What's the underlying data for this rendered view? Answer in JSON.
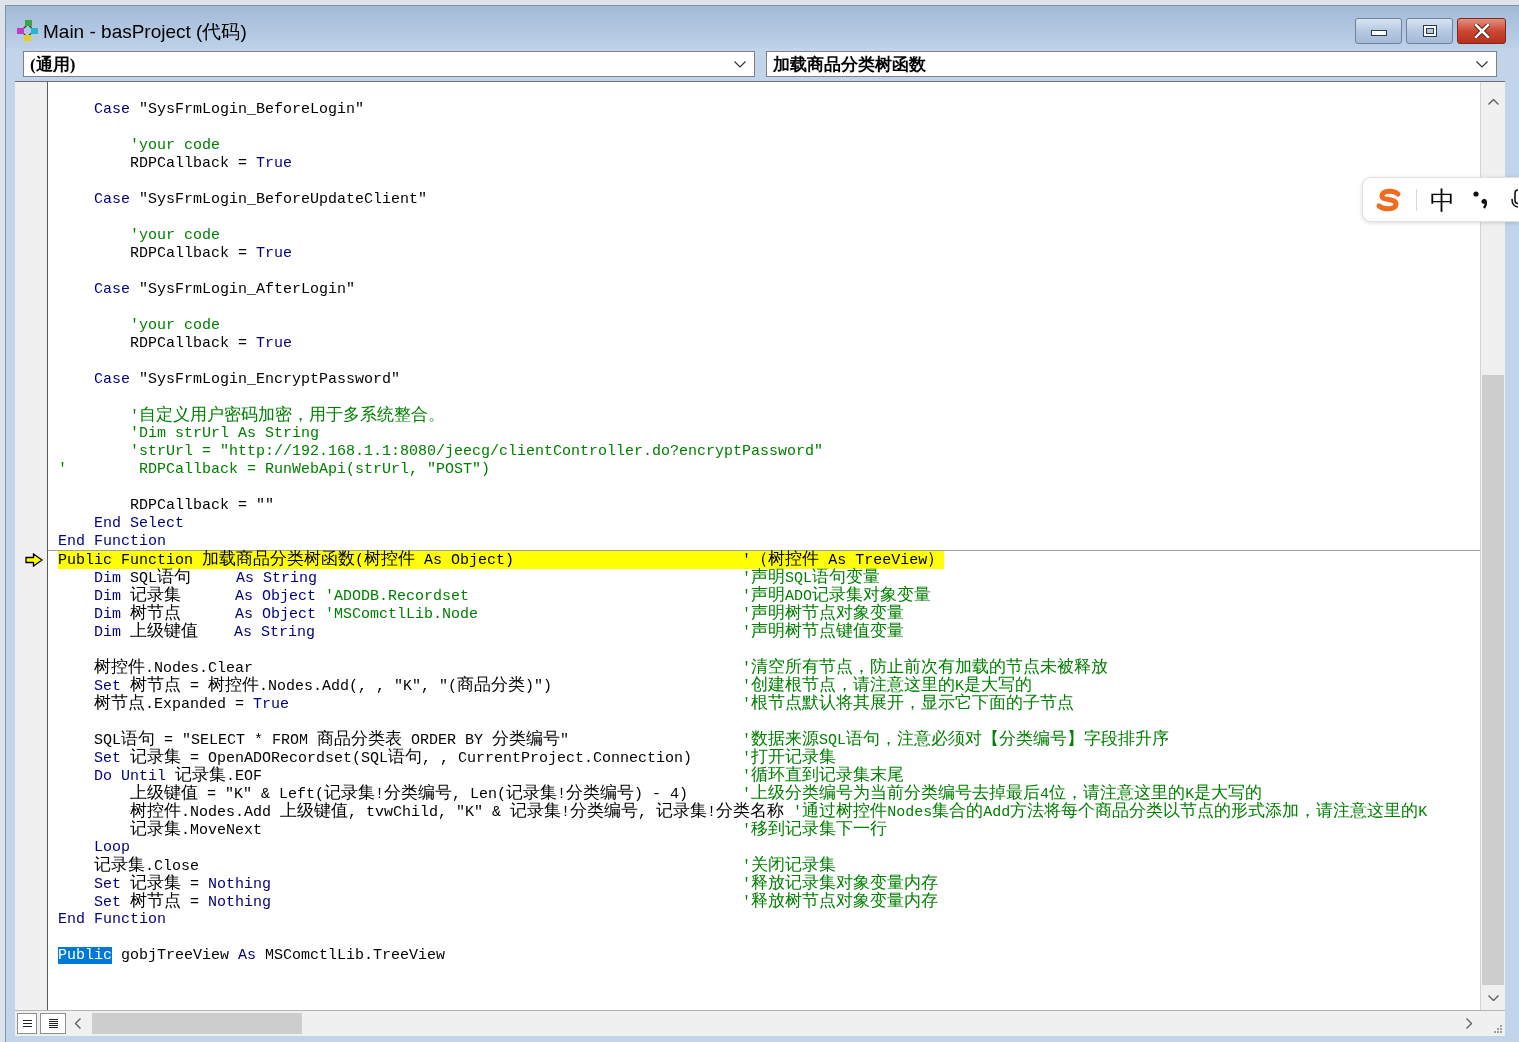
{
  "window": {
    "title": "Main - basProject (代码)"
  },
  "object_dropdown": {
    "value": "(通用)"
  },
  "procedure_dropdown": {
    "value": "加载商品分类树函数"
  },
  "code": {
    "procedures": [
      {
        "lines": [
          {
            "kind": "code",
            "current": false,
            "segments": [
              {
                "kind": "keyword",
                "text": "    Case"
              },
              {
                "kind": "plain",
                "text": " \"SysFrmLogin_BeforeLogin\""
              }
            ]
          },
          {
            "kind": "blank"
          },
          {
            "kind": "code",
            "current": false,
            "segments": [
              {
                "kind": "comment",
                "text": "        'your code"
              }
            ]
          },
          {
            "kind": "code",
            "current": false,
            "segments": [
              {
                "kind": "plain",
                "text": "        RDPCallback = "
              },
              {
                "kind": "keyword",
                "text": "True"
              }
            ]
          },
          {
            "kind": "blank"
          },
          {
            "kind": "code",
            "current": false,
            "segments": [
              {
                "kind": "keyword",
                "text": "    Case"
              },
              {
                "kind": "plain",
                "text": " \"SysFrmLogin_BeforeUpdateClient\""
              }
            ]
          },
          {
            "kind": "blank"
          },
          {
            "kind": "code",
            "current": false,
            "segments": [
              {
                "kind": "comment",
                "text": "        'your code"
              }
            ]
          },
          {
            "kind": "code",
            "current": false,
            "segments": [
              {
                "kind": "plain",
                "text": "        RDPCallback = "
              },
              {
                "kind": "keyword",
                "text": "True"
              }
            ]
          },
          {
            "kind": "blank"
          },
          {
            "kind": "code",
            "current": false,
            "segments": [
              {
                "kind": "keyword",
                "text": "    Case"
              },
              {
                "kind": "plain",
                "text": " \"SysFrmLogin_AfterLogin\""
              }
            ]
          },
          {
            "kind": "blank"
          },
          {
            "kind": "code",
            "current": false,
            "segments": [
              {
                "kind": "comment",
                "text": "        'your code"
              }
            ]
          },
          {
            "kind": "code",
            "current": false,
            "segments": [
              {
                "kind": "plain",
                "text": "        RDPCallback = "
              },
              {
                "kind": "keyword",
                "text": "True"
              }
            ]
          },
          {
            "kind": "blank"
          },
          {
            "kind": "code",
            "current": false,
            "segments": [
              {
                "kind": "keyword",
                "text": "    Case"
              },
              {
                "kind": "plain",
                "text": " \"SysFrmLogin_EncryptPassword\""
              }
            ]
          },
          {
            "kind": "blank"
          },
          {
            "kind": "code",
            "current": false,
            "segments": [
              {
                "kind": "comment",
                "text": "        '自定义用户密码加密，用于多系统整合。"
              }
            ]
          },
          {
            "kind": "code",
            "current": false,
            "segments": [
              {
                "kind": "comment",
                "text": "        'Dim strUrl As String"
              }
            ]
          },
          {
            "kind": "code",
            "current": false,
            "segments": [
              {
                "kind": "comment",
                "text": "        'strUrl = \"http://192.168.1.1:8080/jeecg/clientController.do?encryptPassword\""
              }
            ]
          },
          {
            "kind": "code",
            "current": false,
            "segments": [
              {
                "kind": "comment",
                "text": "'        RDPCallback = RunWebApi(strUrl, \"POST\")"
              }
            ]
          },
          {
            "kind": "blank"
          },
          {
            "kind": "code",
            "current": false,
            "segments": [
              {
                "kind": "plain",
                "text": "        RDPCallback = \"\""
              }
            ]
          },
          {
            "kind": "code",
            "current": false,
            "segments": [
              {
                "kind": "keyword",
                "text": "    End Select"
              }
            ]
          },
          {
            "kind": "code",
            "current": false,
            "segments": [
              {
                "kind": "keyword",
                "text": "End Function"
              }
            ]
          }
        ]
      },
      {
        "lines": [
          {
            "kind": "code",
            "current": true,
            "segments": [
              {
                "kind": "plain",
                "text": "Public Function 加载商品分类树函数(树控件 As Object)"
              }
            ],
            "comment": "'（树控件 As TreeView）"
          },
          {
            "kind": "code",
            "current": false,
            "segments": [
              {
                "kind": "keyword",
                "text": "    Dim"
              },
              {
                "kind": "plain",
                "text": " SQL语句     "
              },
              {
                "kind": "keyword",
                "text": "As String"
              }
            ],
            "comment": "'声明SQL语句变量"
          },
          {
            "kind": "code",
            "current": false,
            "segments": [
              {
                "kind": "keyword",
                "text": "    Dim"
              },
              {
                "kind": "plain",
                "text": " 记录集      "
              },
              {
                "kind": "keyword",
                "text": "As Object"
              },
              {
                "kind": "comment",
                "text": " 'ADODB.Recordset"
              }
            ],
            "comment": "'声明ADO记录集对象变量"
          },
          {
            "kind": "code",
            "current": false,
            "segments": [
              {
                "kind": "keyword",
                "text": "    Dim"
              },
              {
                "kind": "plain",
                "text": " 树节点      "
              },
              {
                "kind": "keyword",
                "text": "As Object"
              },
              {
                "kind": "comment",
                "text": " 'MSComctlLib.Node"
              }
            ],
            "comment": "'声明树节点对象变量"
          },
          {
            "kind": "code",
            "current": false,
            "segments": [
              {
                "kind": "keyword",
                "text": "    Dim"
              },
              {
                "kind": "plain",
                "text": " 上级键值    "
              },
              {
                "kind": "keyword",
                "text": "As String"
              }
            ],
            "comment": "'声明树节点键值变量"
          },
          {
            "kind": "blank"
          },
          {
            "kind": "code",
            "current": false,
            "segments": [
              {
                "kind": "plain",
                "text": "    树控件.Nodes.Clear"
              }
            ],
            "comment": "'清空所有节点，防止前次有加载的节点未被释放"
          },
          {
            "kind": "code",
            "current": false,
            "segments": [
              {
                "kind": "keyword",
                "text": "    Set"
              },
              {
                "kind": "plain",
                "text": " 树节点 = 树控件.Nodes.Add(, , \"K\", \"(商品分类)\")"
              }
            ],
            "comment": "'创建根节点，请注意这里的K是大写的"
          },
          {
            "kind": "code",
            "current": false,
            "segments": [
              {
                "kind": "plain",
                "text": "    树节点.Expanded = "
              },
              {
                "kind": "keyword",
                "text": "True"
              }
            ],
            "comment": "'根节点默认将其展开，显示它下面的子节点"
          },
          {
            "kind": "blank"
          },
          {
            "kind": "code",
            "current": false,
            "segments": [
              {
                "kind": "plain",
                "text": "    SQL语句 = \"SELECT * FROM 商品分类表 ORDER BY 分类编号\""
              }
            ],
            "comment": "'数据来源SQL语句，注意必须对【分类编号】字段排升序"
          },
          {
            "kind": "code",
            "current": false,
            "segments": [
              {
                "kind": "keyword",
                "text": "    Set"
              },
              {
                "kind": "plain",
                "text": " 记录集 = OpenADORecordset(SQL语句, , CurrentProject.Connection)"
              }
            ],
            "comment": "'打开记录集"
          },
          {
            "kind": "code",
            "current": false,
            "segments": [
              {
                "kind": "keyword",
                "text": "    Do Until"
              },
              {
                "kind": "plain",
                "text": " 记录集.EOF"
              }
            ],
            "comment": "'循环直到记录集末尾"
          },
          {
            "kind": "code",
            "current": false,
            "segments": [
              {
                "kind": "plain",
                "text": "        上级键值 = \"K\" & Left(记录集!分类编号, Len(记录集!分类编号) - 4)"
              }
            ],
            "comment": "'上级分类编号为当前分类编号去掉最后4位，请注意这里的K是大写的"
          },
          {
            "kind": "code",
            "current": false,
            "segments": [
              {
                "kind": "plain",
                "text": "        树控件.Nodes.Add 上级键值, tvwChild, \"K\" & 记录集!分类编号, 记录集!分类名称"
              }
            ],
            "comment": "'通过树控件Nodes集合的Add方法将每个商品分类以节点的形式添加，请注意这里的K"
          },
          {
            "kind": "code",
            "current": false,
            "segments": [
              {
                "kind": "plain",
                "text": "        记录集.MoveNext"
              }
            ],
            "comment": "'移到记录集下一行"
          },
          {
            "kind": "code",
            "current": false,
            "segments": [
              {
                "kind": "keyword",
                "text": "    Loop"
              }
            ]
          },
          {
            "kind": "code",
            "current": false,
            "segments": [
              {
                "kind": "plain",
                "text": "    记录集.Close"
              }
            ],
            "comment": "'关闭记录集"
          },
          {
            "kind": "code",
            "current": false,
            "segments": [
              {
                "kind": "keyword",
                "text": "    Set"
              },
              {
                "kind": "plain",
                "text": " 记录集 = "
              },
              {
                "kind": "keyword",
                "text": "Nothing"
              }
            ],
            "comment": "'释放记录集对象变量内存"
          },
          {
            "kind": "code",
            "current": false,
            "segments": [
              {
                "kind": "keyword",
                "text": "    Set"
              },
              {
                "kind": "plain",
                "text": " 树节点 = "
              },
              {
                "kind": "keyword",
                "text": "Nothing"
              }
            ],
            "comment": "'释放树节点对象变量内存"
          },
          {
            "kind": "code",
            "current": false,
            "segments": [
              {
                "kind": "keyword",
                "text": "End Function"
              }
            ]
          },
          {
            "kind": "blank"
          },
          {
            "kind": "code",
            "current": false,
            "segments": [
              {
                "kind": "selected",
                "text": "Public"
              },
              {
                "kind": "plain",
                "text": " gobjTreeView "
              },
              {
                "kind": "keyword",
                "text": "As"
              },
              {
                "kind": "plain",
                "text": " MSComctlLib.TreeView"
              }
            ]
          }
        ]
      }
    ]
  },
  "ime_toolbar": {
    "mode": "中"
  }
}
